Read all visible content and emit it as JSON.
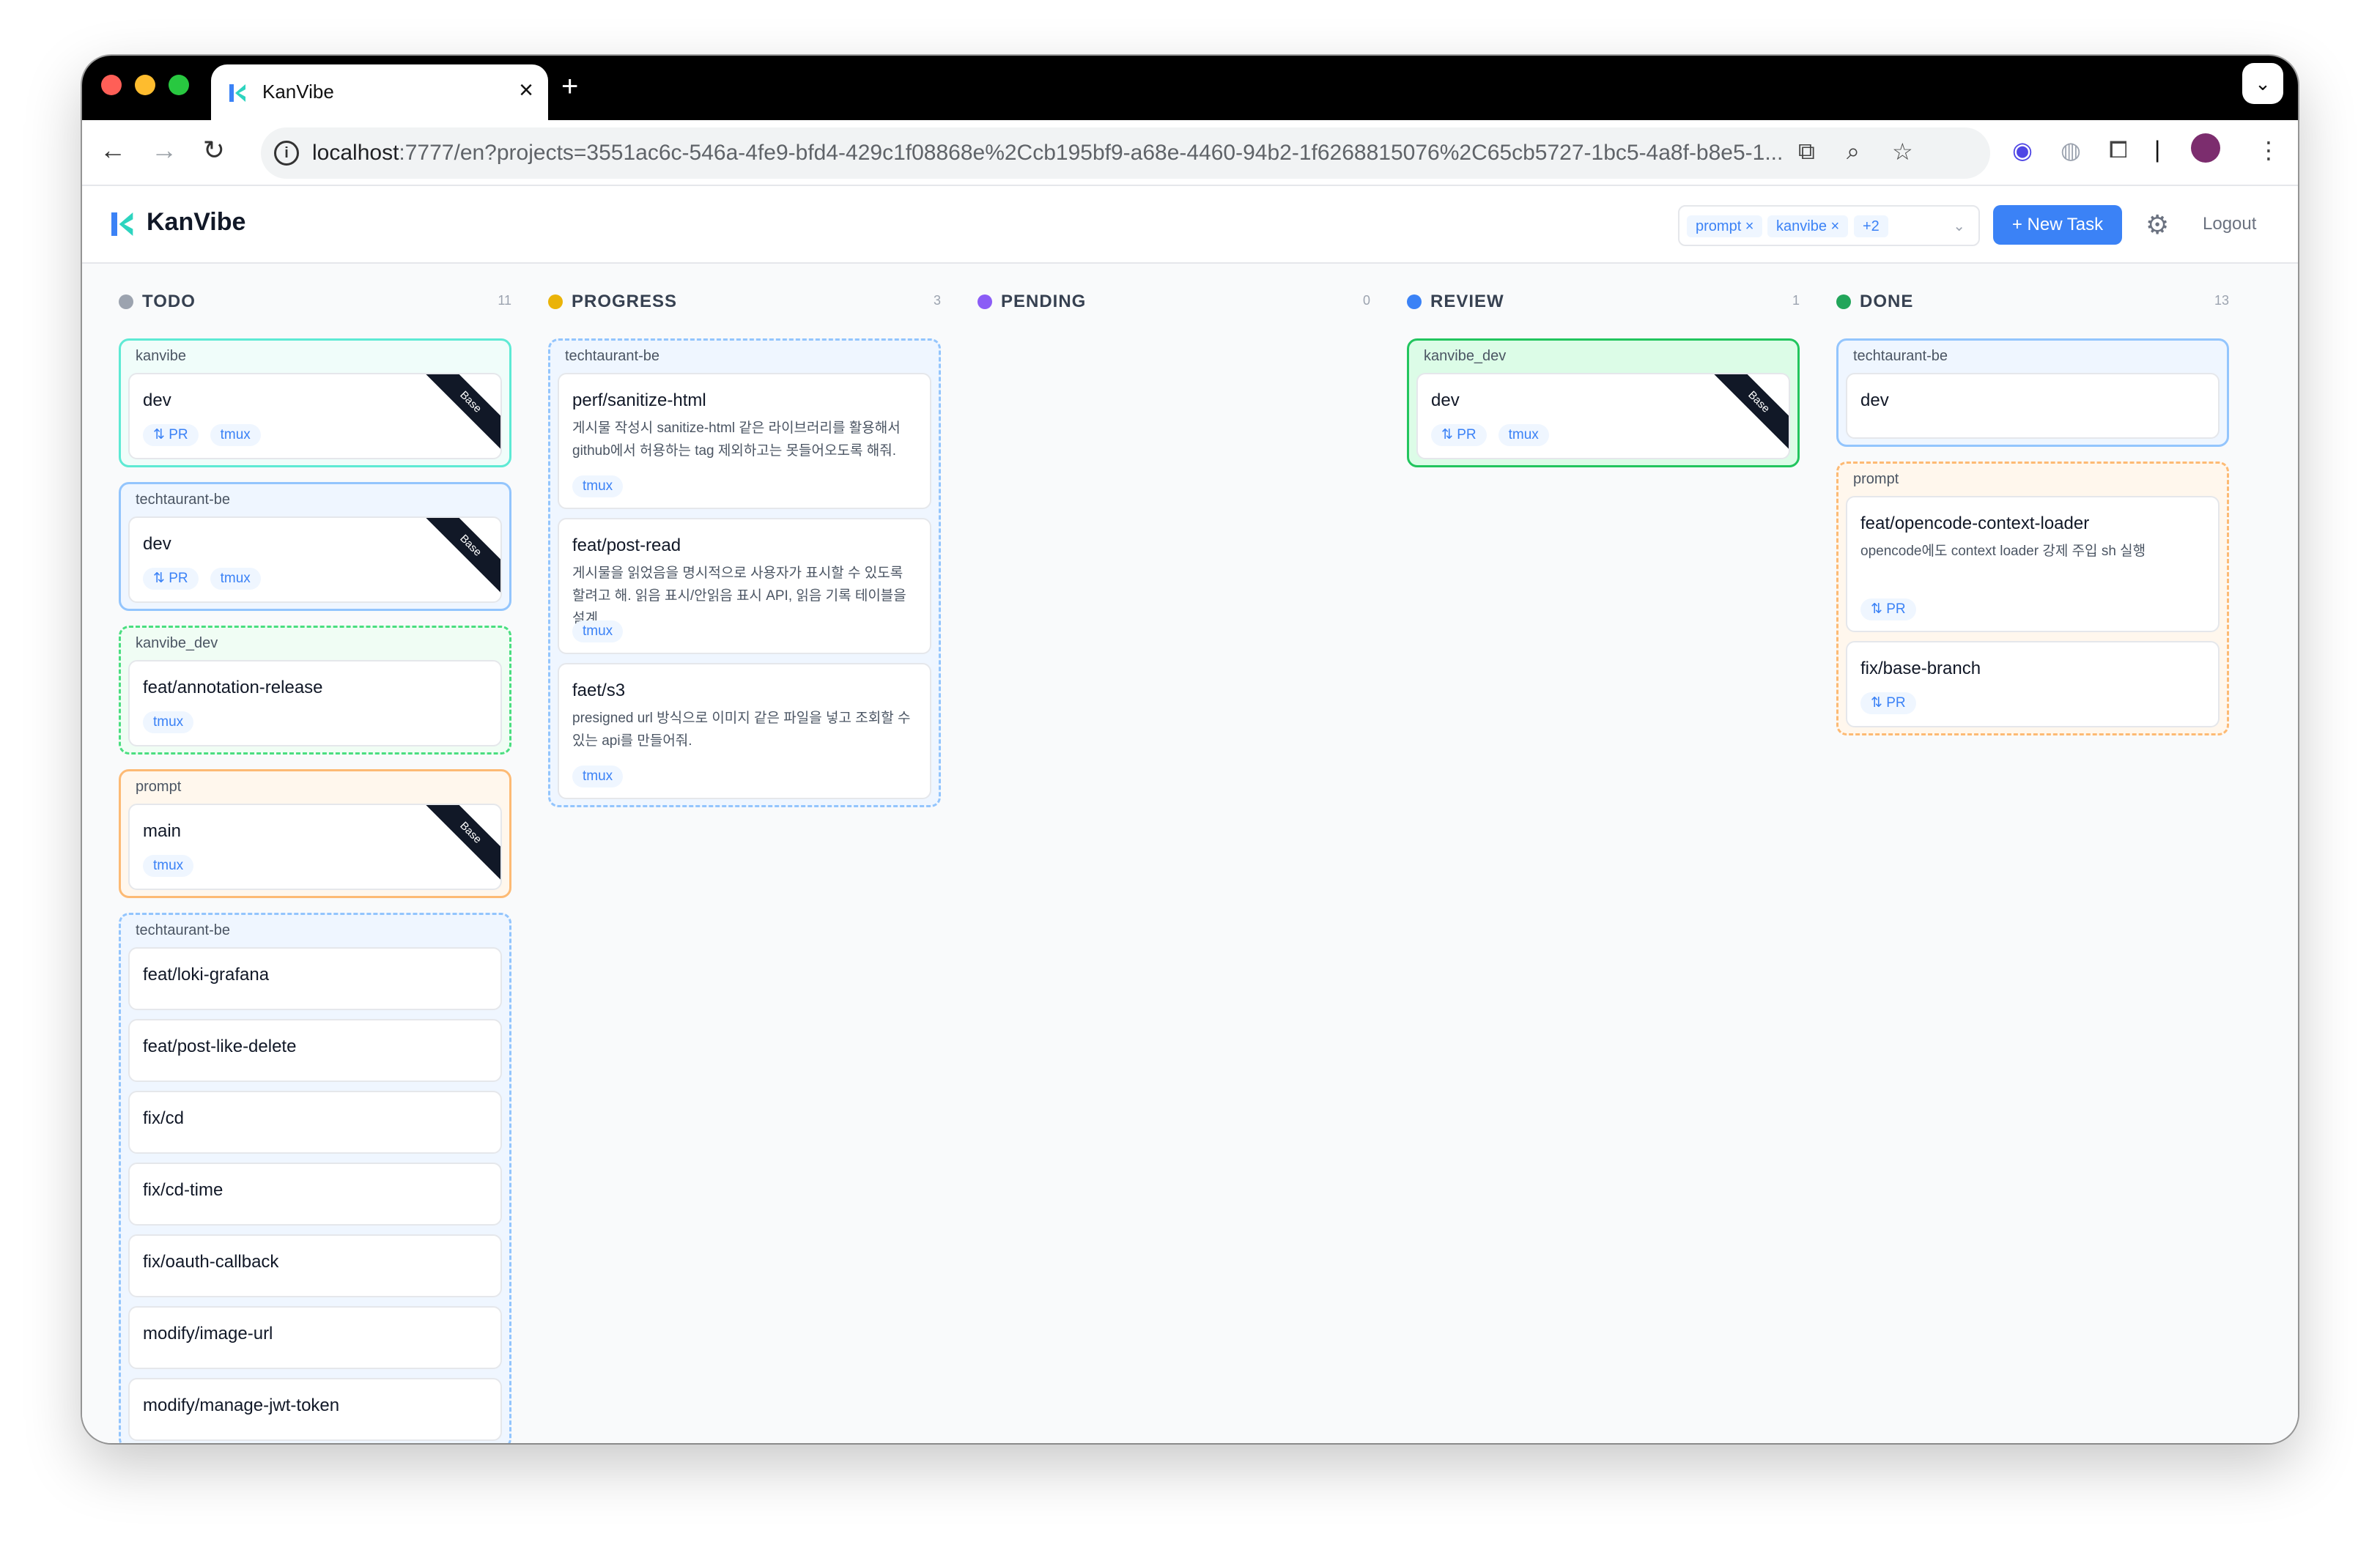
{
  "browser": {
    "tab_title": "KanVibe",
    "new_tab": "+",
    "close": "×",
    "url_host": "localhost",
    "url_rest": ":7777/en?projects=3551ac6c-546a-4fe9-bfd4-429c1f08868e%2Ccb195bf9-a68e-4460-94b2-1f6268815076%2C65cb5727-1bc5-4a8f-b8e5-1..."
  },
  "app": {
    "brand": "KanVibe",
    "filter_chips": [
      "prompt ×",
      "kanvibe ×",
      "+2"
    ],
    "new_task": "+ New Task",
    "logout": "Logout"
  },
  "columns": [
    {
      "name": "TODO",
      "count": "11",
      "color": "#9ca3af",
      "groups": [
        {
          "label": "kanvibe",
          "style": "solid",
          "border": "#5eead4",
          "bg": "#f0fdfa",
          "cards": [
            {
              "title": "dev",
              "tags": [
                "PR",
                "tmux"
              ],
              "base": "Base"
            }
          ]
        },
        {
          "label": "techtaurant-be",
          "style": "solid",
          "border": "#93c5fd",
          "bg": "#eff6ff",
          "cards": [
            {
              "title": "dev",
              "tags": [
                "PR",
                "tmux"
              ],
              "base": "Base"
            }
          ]
        },
        {
          "label": "kanvibe_dev",
          "style": "dashed",
          "border": "#4ade80",
          "bg": "#f0fdf4",
          "cards": [
            {
              "title": "feat/annotation-release",
              "tags": [
                "tmux"
              ]
            }
          ]
        },
        {
          "label": "prompt",
          "style": "solid",
          "border": "#fdba74",
          "bg": "#fff7ed",
          "cards": [
            {
              "title": "main",
              "tags": [
                "tmux"
              ],
              "base": "Base"
            }
          ]
        },
        {
          "label": "techtaurant-be",
          "style": "dashed",
          "border": "#93c5fd",
          "bg": "#eff6ff",
          "cards": [
            {
              "title": "feat/loki-grafana"
            },
            {
              "title": "feat/post-like-delete"
            },
            {
              "title": "fix/cd"
            },
            {
              "title": "fix/cd-time"
            },
            {
              "title": "fix/oauth-callback"
            },
            {
              "title": "modify/image-url"
            },
            {
              "title": "modify/manage-jwt-token"
            }
          ]
        }
      ]
    },
    {
      "name": "PROGRESS",
      "count": "3",
      "color": "#eab308",
      "groups": [
        {
          "label": "techtaurant-be",
          "style": "dashed",
          "border": "#93c5fd",
          "bg": "#eff6ff",
          "cards": [
            {
              "title": "perf/sanitize-html",
              "desc": "게시물 작성시 sanitize-html 같은 라이브러리를 활용해서 github에서 허용하는 tag 제외하고는 못들어오도록 해줘.",
              "tags": [
                "tmux"
              ]
            },
            {
              "title": "feat/post-read",
              "desc": "게시물을 읽었음을 명시적으로 사용자가 표시할 수 있도록 할려고 해. 읽음 표시/안읽음 표시 API, 읽음 기록 테이블을 설계...",
              "tags": [
                "tmux"
              ]
            },
            {
              "title": "faet/s3",
              "desc": "presigned url 방식으로 이미지 같은 파일을 넣고 조회할 수 있는 api를 만들어줘.",
              "tags": [
                "tmux"
              ]
            }
          ]
        }
      ]
    },
    {
      "name": "PENDING",
      "count": "0",
      "color": "#8b5cf6",
      "groups": []
    },
    {
      "name": "REVIEW",
      "count": "1",
      "color": "#3b82f6",
      "groups": [
        {
          "label": "kanvibe_dev",
          "style": "solid",
          "border": "#22c55e",
          "bg": "#dcfce7",
          "cards": [
            {
              "title": "dev",
              "tags": [
                "PR",
                "tmux"
              ],
              "base": "Base"
            }
          ]
        }
      ]
    },
    {
      "name": "DONE",
      "count": "13",
      "color": "#22a55a",
      "groups": [
        {
          "label": "techtaurant-be",
          "style": "solid",
          "border": "#93c5fd",
          "bg": "#eff6ff",
          "cards": [
            {
              "title": "dev"
            }
          ]
        },
        {
          "label": "prompt",
          "style": "dashed",
          "border": "#fdba74",
          "bg": "#fff7ed",
          "cards": [
            {
              "title": "feat/opencode-context-loader",
              "desc": "opencode에도 context loader 강제 주입 sh 실행",
              "tags": [
                "PR"
              ]
            },
            {
              "title": "fix/base-branch",
              "tags": [
                "PR"
              ]
            }
          ]
        }
      ]
    }
  ]
}
